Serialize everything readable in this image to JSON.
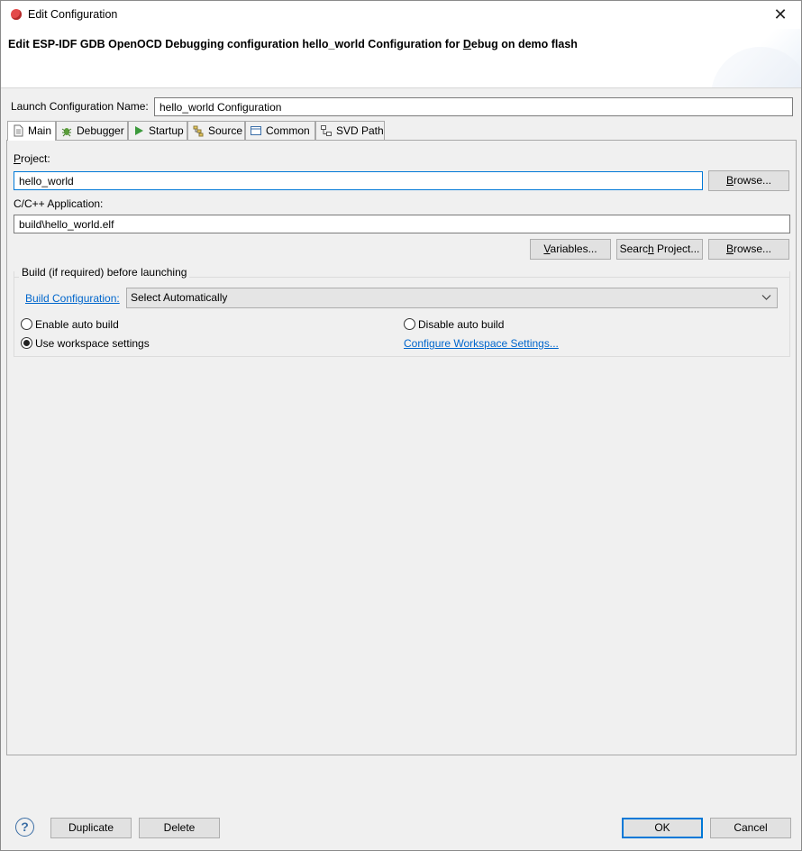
{
  "window": {
    "title": "Edit Configuration",
    "close_glyph": "✕"
  },
  "banner": {
    "title_prefix": "Edit ESP-IDF GDB OpenOCD Debugging configuration hello_world Configuration for ",
    "title_mnemonic": "D",
    "title_suffix": "ebug on demo flash"
  },
  "launch_config": {
    "label": "Launch Configuration Name:",
    "value": "hello_world Configuration"
  },
  "tabs": [
    {
      "label": "Main",
      "icon": "document-icon"
    },
    {
      "label": "Debugger",
      "icon": "bug-icon"
    },
    {
      "label": "Startup",
      "icon": "play-icon"
    },
    {
      "label": "Source",
      "icon": "source-icon"
    },
    {
      "label": "Common",
      "icon": "common-icon"
    },
    {
      "label": "SVD Path",
      "icon": "svd-icon"
    }
  ],
  "main": {
    "project_label_mn": "P",
    "project_label_rest": "roject:",
    "project_value": "hello_world",
    "browse_project_mn": "B",
    "browse_project_rest": "rowse...",
    "app_label": "C/C++ Application:",
    "app_value": "build\\hello_world.elf",
    "variables_mn": "V",
    "variables_rest": "ariables...",
    "search_prefix": "Searc",
    "search_mn": "h",
    "search_rest": " Project...",
    "browse_app_mn": "B",
    "browse_app_rest": "rowse...",
    "build_group_title": "Build (if required) before launching",
    "build_config_link": "Build Configuration:",
    "build_config_value": "Select Automatically",
    "radio_enable": "Enable auto build",
    "radio_disable": "Disable auto build",
    "radio_workspace": "Use workspace settings",
    "configure_link": "Configure Workspace Settings...",
    "selected_radio": "Use workspace settings"
  },
  "footer": {
    "help_glyph": "?",
    "duplicate": "Duplicate",
    "delete": "Delete",
    "ok": "OK",
    "cancel": "Cancel"
  }
}
